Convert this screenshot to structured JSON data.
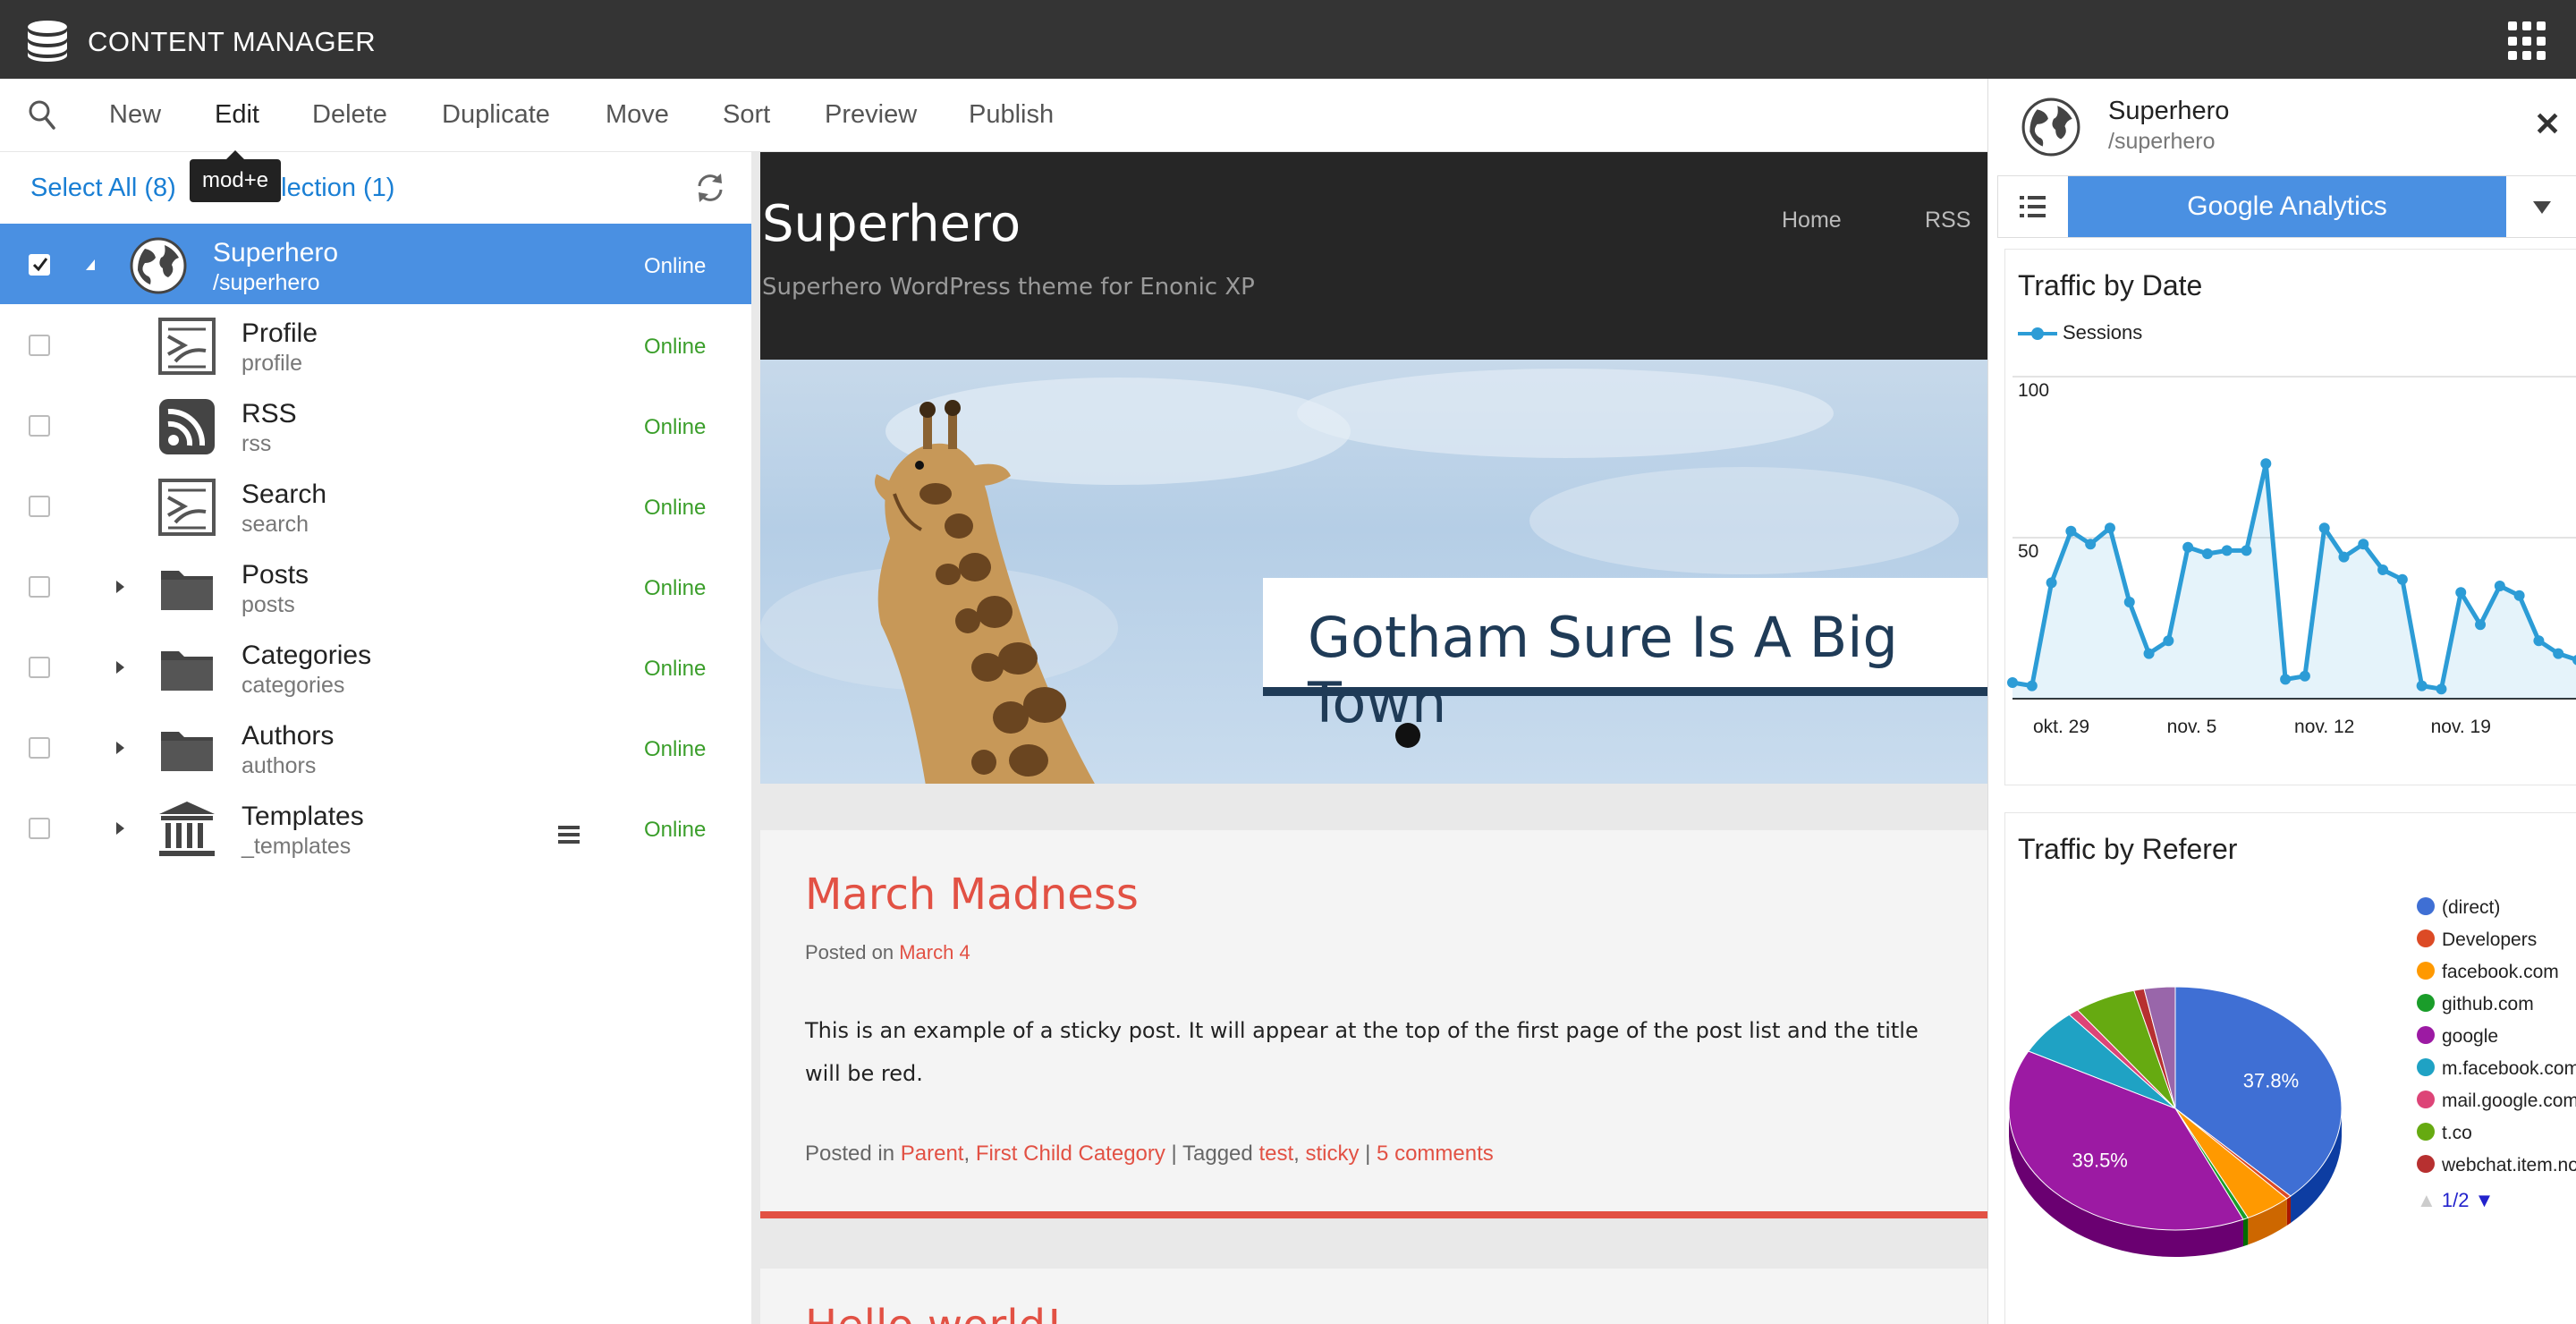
{
  "app": {
    "title": "CONTENT MANAGER",
    "logo_icon": "database-icon",
    "launcher_icon": "app-grid-icon"
  },
  "toolbar": {
    "search_icon": "search-icon",
    "buttons": [
      "New",
      "Edit",
      "Delete",
      "Duplicate",
      "Move",
      "Sort",
      "Preview",
      "Publish"
    ],
    "tooltip": "mod+e"
  },
  "selection": {
    "select_all": "Select All (8)",
    "show_selection": "Show Selection (1)",
    "show_selection_visible": "election (1)"
  },
  "tree": [
    {
      "name": "Superhero",
      "path": "/superhero",
      "status": "Online",
      "icon": "globe-icon",
      "selected": true,
      "expanded": true
    },
    {
      "name": "Profile",
      "path": "profile",
      "status": "Online",
      "icon": "page-icon"
    },
    {
      "name": "RSS",
      "path": "rss",
      "status": "Online",
      "icon": "rss-icon"
    },
    {
      "name": "Search",
      "path": "search",
      "status": "Online",
      "icon": "page-icon"
    },
    {
      "name": "Posts",
      "path": "posts",
      "status": "Online",
      "icon": "folder-icon",
      "expandable": true
    },
    {
      "name": "Categories",
      "path": "categories",
      "status": "Online",
      "icon": "folder-icon",
      "expandable": true
    },
    {
      "name": "Authors",
      "path": "authors",
      "status": "Online",
      "icon": "folder-icon",
      "expandable": true
    },
    {
      "name": "Templates",
      "path": "_templates",
      "status": "Online",
      "icon": "templates-icon",
      "expandable": true
    }
  ],
  "site": {
    "title": "Superhero",
    "subtitle": "Superhero WordPress theme for Enonic XP",
    "nav": [
      "Home",
      "RSS"
    ],
    "hero_caption": "Gotham Sure Is A Big Town",
    "post": {
      "title": "March Madness",
      "posted_prefix": "Posted on",
      "date": "March 4",
      "body": "This is an example of a sticky post. It will appear at the top of the first page of the post list and the title will be red.",
      "posted_in": "Posted in",
      "categories": [
        "Parent",
        "First Child Category"
      ],
      "tagged": "Tagged",
      "tags": [
        "test",
        "sticky"
      ],
      "comments": "5 comments"
    },
    "next_post_title": "Hello world!"
  },
  "right_panel": {
    "name": "Superhero",
    "path": "/superhero",
    "widget": "Google Analytics",
    "close_icon": "close-icon"
  },
  "colors": {
    "accent": "#4a90e2",
    "status_online": "#3a9e2a",
    "post_red": "#e25144",
    "line": "#2c9cd6"
  },
  "chart_data": [
    {
      "type": "line",
      "title": "Traffic by Date",
      "series": [
        {
          "name": "Sessions",
          "values": [
            5,
            4,
            36,
            52,
            48,
            53,
            30,
            14,
            18,
            47,
            45,
            46,
            46,
            73,
            6,
            7,
            53,
            44,
            48,
            40,
            37,
            4,
            3,
            33,
            23,
            35,
            32,
            18,
            14,
            12
          ]
        }
      ],
      "x_tick_labels": [
        "okt. 29",
        "nov. 5",
        "nov. 12",
        "nov. 19"
      ],
      "y_tick_labels": [
        "100",
        "50"
      ],
      "ylim": [
        0,
        100
      ],
      "grid": true,
      "legend": "top-left"
    },
    {
      "type": "pie",
      "title": "Traffic by Referer",
      "labels": [
        "(direct)",
        "Developers",
        "facebook.com",
        "github.com",
        "google",
        "m.facebook.com",
        "mail.google.com",
        "t.co",
        "webchat.item.no"
      ],
      "values": [
        37.8,
        0.5,
        4.5,
        0.5,
        39.5,
        6.2,
        1.0,
        6.0,
        1.0,
        3.0
      ],
      "slice_labels": [
        "37.8%",
        "39.5%"
      ],
      "colors": [
        "#3f6fd4",
        "#dc4a25",
        "#ff9900",
        "#1a9d2a",
        "#9c1aa3",
        "#1fa2c4",
        "#dd4477",
        "#66aa11",
        "#b73030",
        "#9966aa",
        "#22aa99"
      ],
      "legend_pager": "1/2",
      "legend": "right"
    }
  ]
}
